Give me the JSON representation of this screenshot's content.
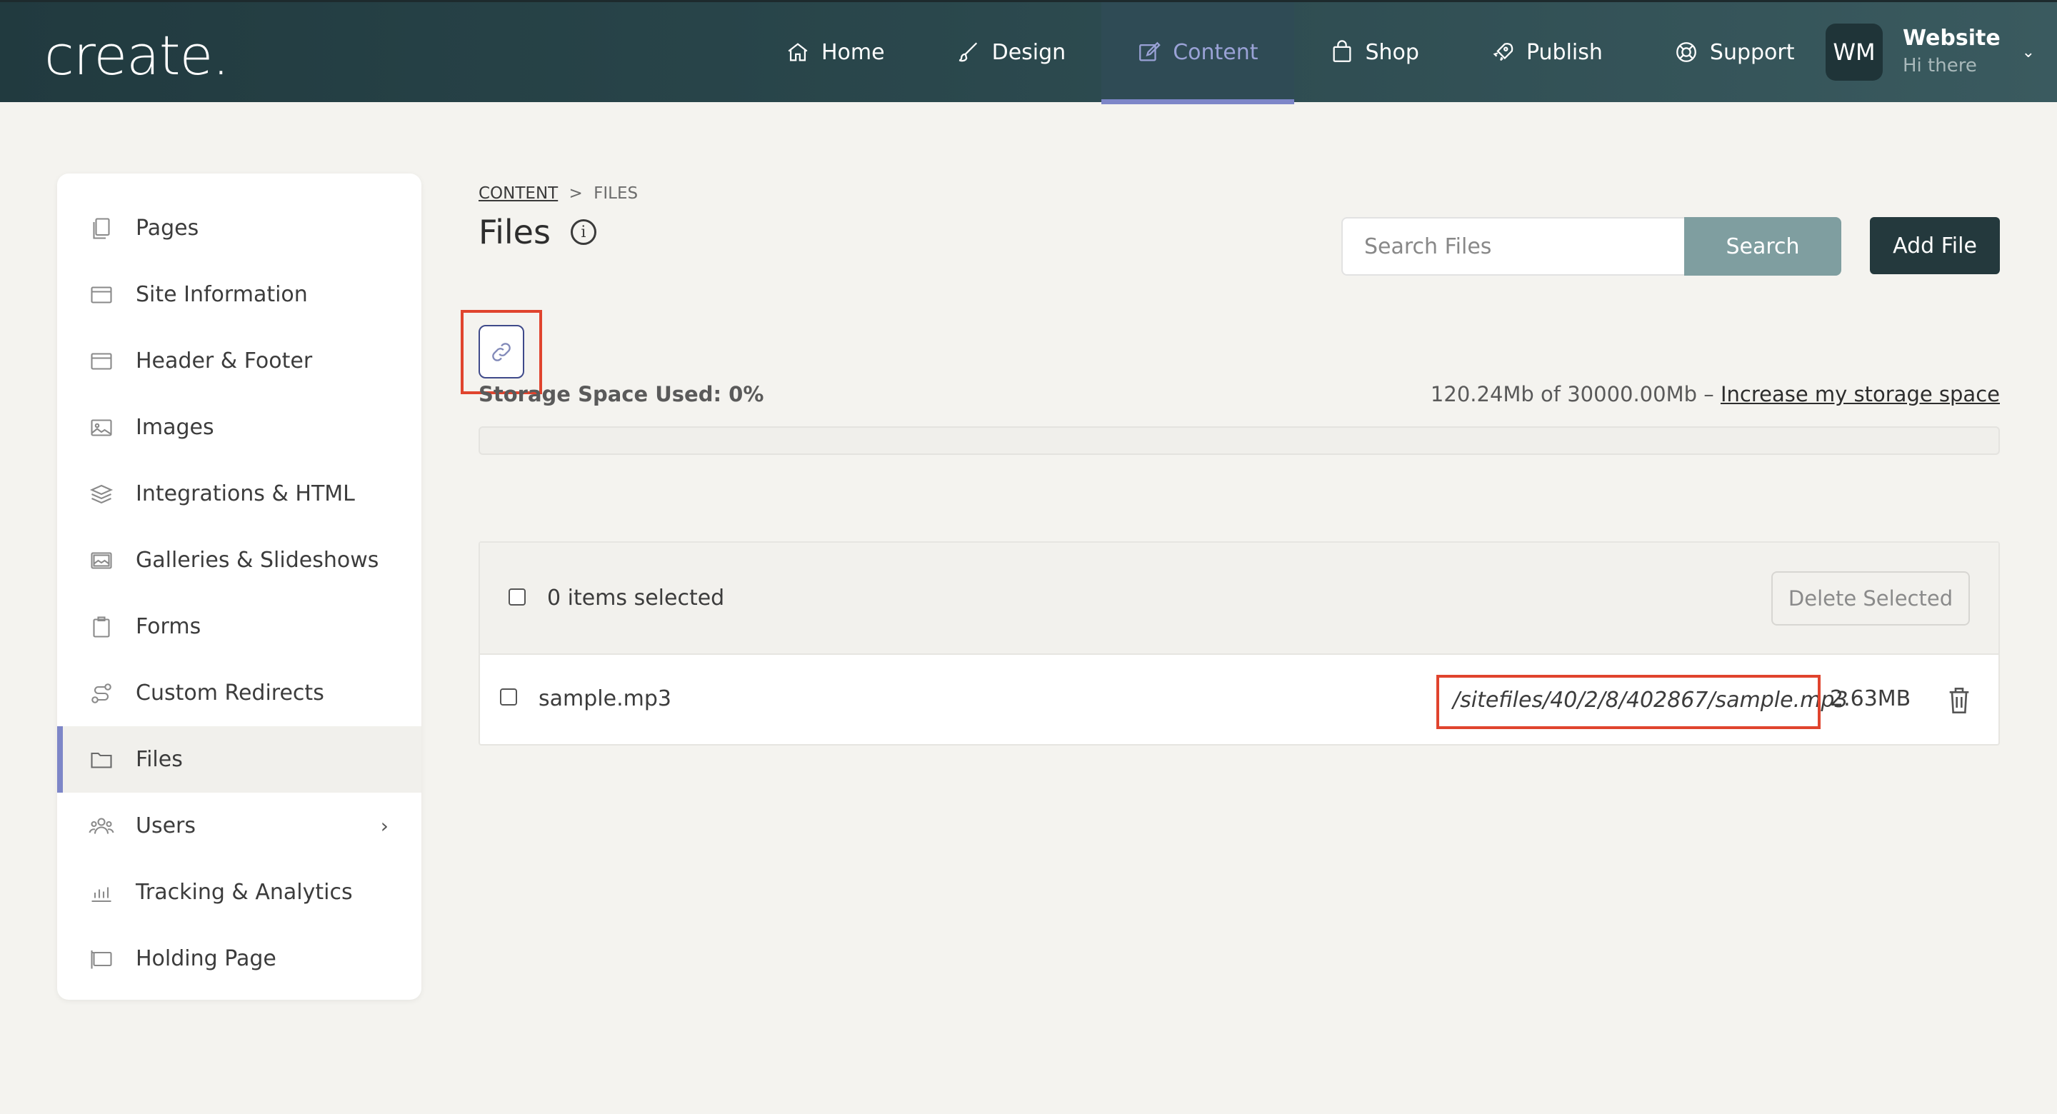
{
  "brand": {
    "logo_text": "create."
  },
  "nav": {
    "items": [
      {
        "label": "Home",
        "icon": "home-icon"
      },
      {
        "label": "Design",
        "icon": "brush-icon"
      },
      {
        "label": "Content",
        "icon": "edit-icon",
        "active": true
      },
      {
        "label": "Shop",
        "icon": "bag-icon"
      },
      {
        "label": "Publish",
        "icon": "rocket-icon"
      },
      {
        "label": "Support",
        "icon": "lifebuoy-icon"
      }
    ]
  },
  "user": {
    "initials": "WM",
    "name": "Website",
    "greeting": "Hi there"
  },
  "sidebar": {
    "items": [
      {
        "label": "Pages",
        "icon": "pages-icon"
      },
      {
        "label": "Site Information",
        "icon": "window-icon"
      },
      {
        "label": "Header & Footer",
        "icon": "window-icon"
      },
      {
        "label": "Images",
        "icon": "image-icon"
      },
      {
        "label": "Integrations & HTML",
        "icon": "layers-icon"
      },
      {
        "label": "Galleries & Slideshows",
        "icon": "gallery-icon"
      },
      {
        "label": "Forms",
        "icon": "clipboard-icon"
      },
      {
        "label": "Custom Redirects",
        "icon": "route-icon"
      },
      {
        "label": "Files",
        "icon": "folder-icon",
        "active": true
      },
      {
        "label": "Users",
        "icon": "users-icon",
        "has_submenu": true
      },
      {
        "label": "Tracking & Analytics",
        "icon": "bar-chart-icon"
      },
      {
        "label": "Holding Page",
        "icon": "holding-icon"
      }
    ]
  },
  "breadcrumb": {
    "root": "CONTENT",
    "separator": ">",
    "current": "FILES"
  },
  "page": {
    "title": "Files"
  },
  "search": {
    "placeholder": "Search Files",
    "button_label": "Search"
  },
  "actions": {
    "add_file": "Add File"
  },
  "storage": {
    "label": "Storage Space Used: 0%",
    "used_percent": 0,
    "usage_text": "120.24Mb of 30000.00Mb – ",
    "increase_link": "Increase my storage space"
  },
  "files_table": {
    "selected_text": "0 items selected",
    "delete_selected_label": "Delete Selected",
    "rows": [
      {
        "name": "sample.mp3",
        "path": "/sitefiles/40/2/8/402867/sample.mp3",
        "size": "2.63MB"
      }
    ]
  },
  "colors": {
    "accent": "#7d86c8",
    "topbar": "#2a474c",
    "search_button": "#7f9ea0",
    "add_button": "#24393d",
    "highlight": "#e0442e"
  }
}
